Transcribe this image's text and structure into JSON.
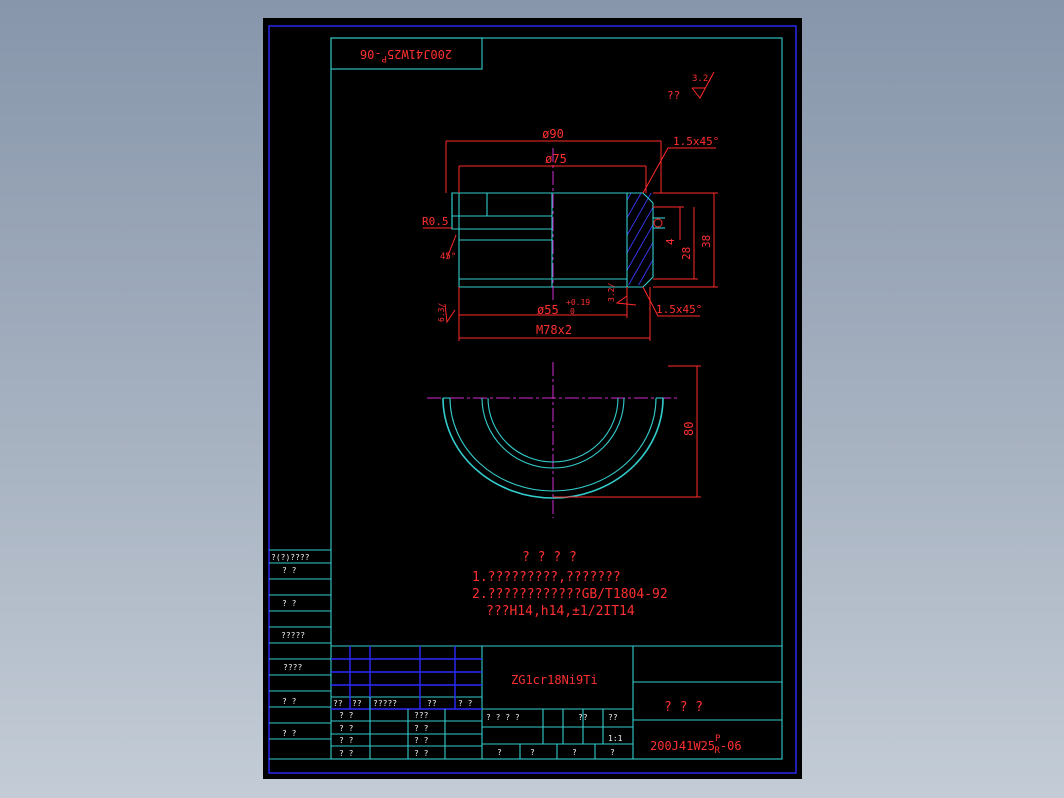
{
  "drawing": {
    "rotated_number": "200J41W25",
    "rotated_number_sup": "P",
    "rotated_number_suffix": "-06",
    "roughness_prefix": "??",
    "roughness_value": "3.2/"
  },
  "dimensions": {
    "d90": "ø90",
    "d75": "ø75",
    "chamfer_top": "1.5x45°",
    "chamfer_bottom": "1.5x45°",
    "d55": "ø55",
    "d55_tol_upper": "+0.19",
    "d55_tol_lower": "0",
    "thread": "M78x2",
    "r05": "R0.5",
    "angle45": "45°",
    "roughness_side": "6.3/",
    "roughness_bottom": "3.2/",
    "roughness_small": "1.6",
    "h4": "4",
    "h28": "28",
    "h38": "38",
    "h80": "80"
  },
  "notes": {
    "title": "? ? ? ?",
    "line1": "1.?????????,???????",
    "line2": "2.????????????GB/T1804-92",
    "line3": "???H14,h14,±1/2IT14"
  },
  "side_block": {
    "header": "?(?)????",
    "rows": [
      "?   ?",
      "?   ?",
      "?????",
      "????",
      "?   ?",
      "?   ?"
    ]
  },
  "title_block": {
    "material": "ZG1cr18Ni9Ti",
    "part_name": "?  ?  ?",
    "number": "200J41W25",
    "number_sup": "P",
    "number_sub": "R",
    "number_suffix": "-06",
    "left_labels": [
      "?? ",
      "??",
      "?????",
      "?? ",
      "? ?"
    ],
    "row_a": [
      "? ?",
      "???"
    ],
    "row_b": [
      "? ?",
      "? ?"
    ],
    "row_c": [
      "? ?",
      "? ?"
    ],
    "row_d": [
      "? ?",
      "? ?"
    ],
    "stage": "? ? ? ?",
    "weight": "??",
    "scale_label": "??",
    "scale": "1:1",
    "sheet_labels": [
      "?",
      "?",
      "?",
      "?"
    ]
  }
}
